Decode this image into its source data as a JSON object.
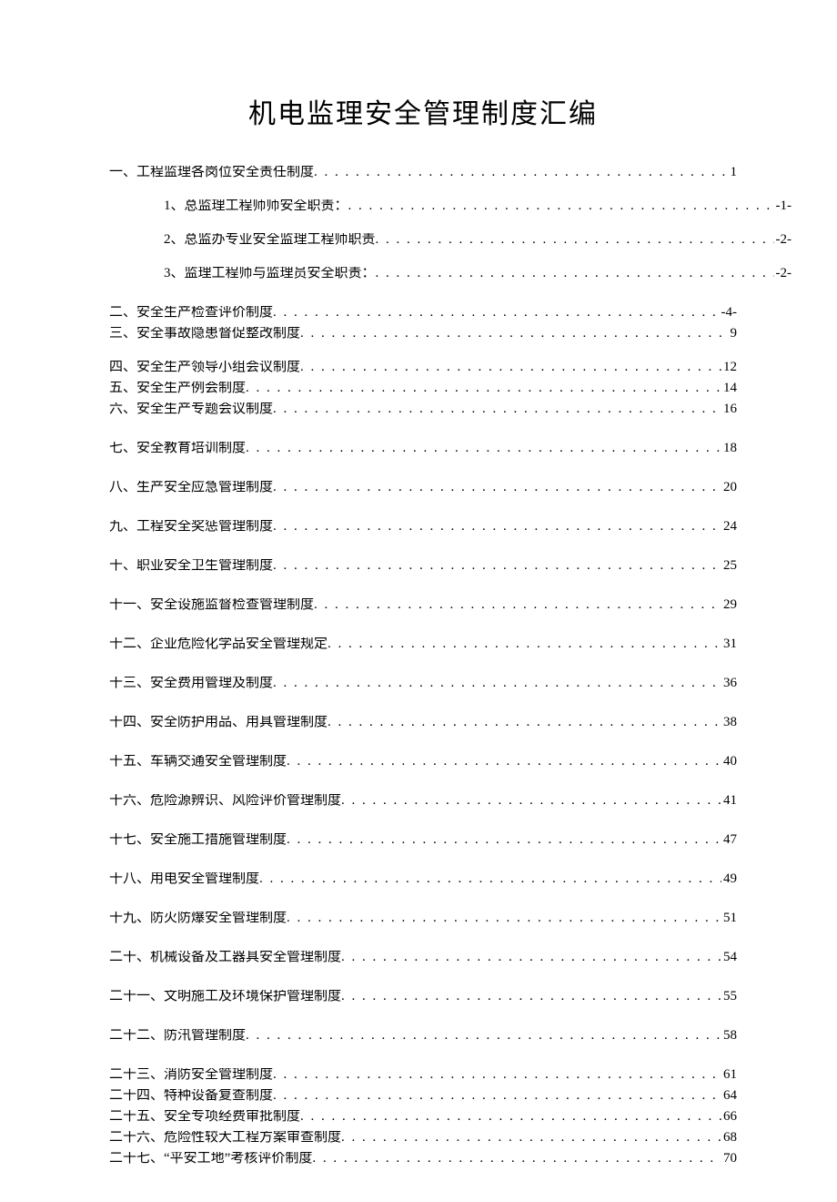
{
  "title": "机电监理安全管理制度汇编",
  "toc": [
    {
      "level": 1,
      "label": "一、工程监理各岗位安全责任制度",
      "page": "1",
      "gap": "gap-small"
    },
    {
      "level": 2,
      "label": "1、总监理工程师师安全职责：",
      "page": "-1-",
      "gap": "gap-large"
    },
    {
      "level": 2,
      "label": "2、总监办专业安全监理工程师职责",
      "page": "-2-",
      "gap": "gap-large"
    },
    {
      "level": 2,
      "label": "3、监理工程师与监理员安全职责：",
      "page": "-2-",
      "gap": "gap-large"
    },
    {
      "level": 1,
      "label": "二、安全生产检查评价制度",
      "page": "-4-",
      "gap": "gap-xl"
    },
    {
      "level": 1,
      "label": "三、安全事故隐患督促整改制度",
      "page": "9",
      "gap": "gap-small"
    },
    {
      "level": 1,
      "label": "四、安全生产领导小组会议制度",
      "page": "12",
      "gap": "gap-large"
    },
    {
      "level": 1,
      "label": "五、安全生产例会制度",
      "page": "14",
      "gap": "gap-small"
    },
    {
      "level": 1,
      "label": "六、安全生产专题会议制度",
      "page": "16",
      "gap": "gap-small"
    },
    {
      "level": 1,
      "label": "七、安全教育培训制度",
      "page": "18",
      "gap": "gap-xl"
    },
    {
      "level": 1,
      "label": "八、生产安全应急管理制度",
      "page": "20",
      "gap": "gap-xl"
    },
    {
      "level": 1,
      "label": "九、工程安全奖惩管理制度",
      "page": "24",
      "gap": "gap-xl"
    },
    {
      "level": 1,
      "label": "十、职业安全卫生管理制度",
      "page": "25",
      "gap": "gap-xl"
    },
    {
      "level": 1,
      "label": "十一、安全设施监督检查管理制度",
      "page": "29",
      "gap": "gap-xl"
    },
    {
      "level": 1,
      "label": "十二、企业危险化学品安全管理规定",
      "page": "31",
      "gap": "gap-xl"
    },
    {
      "level": 1,
      "label": "十三、安全费用管理及制度",
      "page": "36",
      "gap": "gap-xl"
    },
    {
      "level": 1,
      "label": "十四、安全防护用品、用具管理制度",
      "page": "38",
      "gap": "gap-xl"
    },
    {
      "level": 1,
      "label": "十五、车辆交通安全管理制度",
      "page": "40",
      "gap": "gap-xl"
    },
    {
      "level": 1,
      "label": "十六、危险源辨识、风险评价管理制度",
      "page": "41",
      "gap": "gap-xl"
    },
    {
      "level": 1,
      "label": "十七、安全施工措施管理制度",
      "page": "47",
      "gap": "gap-xl"
    },
    {
      "level": 1,
      "label": "十八、用电安全管理制度",
      "page": "49",
      "gap": "gap-xl"
    },
    {
      "level": 1,
      "label": "十九、防火防爆安全管理制度",
      "page": "51",
      "gap": "gap-xl"
    },
    {
      "level": 1,
      "label": "二十、机械设备及工器具安全管理制度",
      "page": "54",
      "gap": "gap-xl"
    },
    {
      "level": 1,
      "label": "二十一、文明施工及环境保护管理制度",
      "page": "55",
      "gap": "gap-xl"
    },
    {
      "level": 1,
      "label": "二十二、防汛管理制度",
      "page": "58",
      "gap": "gap-xl"
    },
    {
      "level": 1,
      "label": "二十三、消防安全管理制度",
      "page": "61",
      "gap": "gap-xl"
    },
    {
      "level": 1,
      "label": "二十四、特种设备复查制度",
      "page": "64",
      "gap": "gap-small"
    },
    {
      "level": 1,
      "label": "二十五、安全专项经费审批制度",
      "page": "66",
      "gap": "gap-small"
    },
    {
      "level": 1,
      "label": "二十六、危险性较大工程方案审查制度",
      "page": "68",
      "gap": "gap-small"
    },
    {
      "level": 1,
      "label": "二十七、“平安工地”考核评价制度",
      "page": "70",
      "gap": "gap-small"
    }
  ]
}
